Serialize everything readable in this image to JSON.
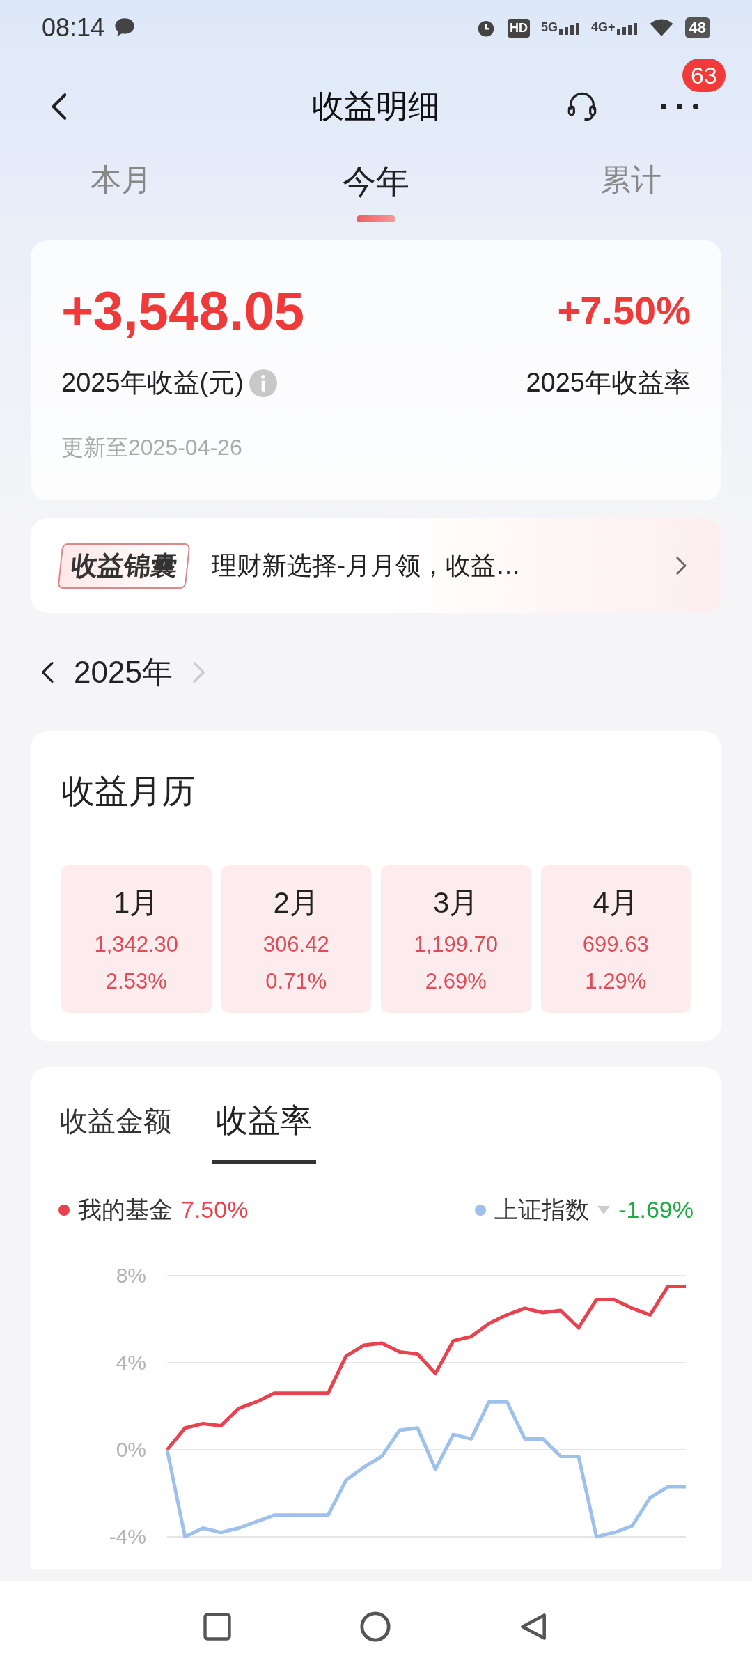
{
  "status_bar": {
    "time": "08:14",
    "network": [
      "HD",
      "5G",
      "4G+"
    ],
    "battery": "48"
  },
  "header": {
    "title": "收益明细",
    "badge": "63"
  },
  "tabs": [
    {
      "label": "本月",
      "selected": false
    },
    {
      "label": "今年",
      "selected": true
    },
    {
      "label": "累计",
      "selected": false
    }
  ],
  "summary": {
    "amount": "+3,548.05",
    "amount_label": "2025年收益(元)",
    "rate": "+7.50%",
    "rate_label": "2025年收益率",
    "updated": "更新至2025-04-26"
  },
  "banner": {
    "tag": "收益锦囊",
    "text": "理财新选择-月月领，收益…"
  },
  "year_nav": {
    "label": "2025年",
    "prev_disabled": false,
    "next_disabled": true
  },
  "calendar": {
    "title": "收益月历",
    "months": [
      {
        "month": "1月",
        "amount": "1,342.30",
        "rate": "2.53%"
      },
      {
        "month": "2月",
        "amount": "306.42",
        "rate": "0.71%"
      },
      {
        "month": "3月",
        "amount": "1,199.70",
        "rate": "2.69%"
      },
      {
        "month": "4月",
        "amount": "699.63",
        "rate": "1.29%"
      }
    ]
  },
  "chart_tabs": [
    {
      "label": "收益金额",
      "selected": false
    },
    {
      "label": "收益率",
      "selected": true
    }
  ],
  "legend": [
    {
      "kind": "static",
      "value": "7.50%",
      "color": "#e8424f"
    },
    {
      "kind": "dropdown",
      "value": "-1.69%",
      "color": "#22a845"
    }
  ],
  "chart_data": {
    "type": "line",
    "grid": true,
    "ylim": [
      -4,
      8
    ],
    "yticks": [
      {
        "value": 8,
        "label": "8%"
      },
      {
        "value": 4,
        "label": "4%"
      },
      {
        "value": 0,
        "label": "0%"
      },
      {
        "value": -4,
        "label": "-4%"
      }
    ],
    "series": [
      {
        "name": "我的基金",
        "color": "#e8424f",
        "values": [
          0,
          1,
          1.2,
          1.1,
          1.9,
          2.2,
          2.6,
          2.6,
          2.6,
          2.6,
          4.3,
          4.8,
          4.9,
          4.5,
          4.4,
          3.5,
          5.0,
          5.2,
          5.8,
          6.2,
          6.5,
          6.3,
          6.4,
          5.6,
          6.9,
          6.9,
          6.5,
          6.2,
          7.5,
          7.5
        ]
      },
      {
        "name": "上证指数",
        "color": "#9dc0ec",
        "values": [
          0,
          -4,
          -3.6,
          -3.8,
          -3.6,
          -3.3,
          -3.0,
          -3.0,
          -3.0,
          -3.0,
          -1.4,
          -0.8,
          -0.3,
          0.9,
          1.0,
          -0.9,
          0.7,
          0.5,
          2.2,
          2.2,
          0.5,
          0.5,
          -0.3,
          -0.3,
          -4,
          -3.8,
          -3.5,
          -2.2,
          -1.7,
          -1.7
        ]
      }
    ]
  }
}
